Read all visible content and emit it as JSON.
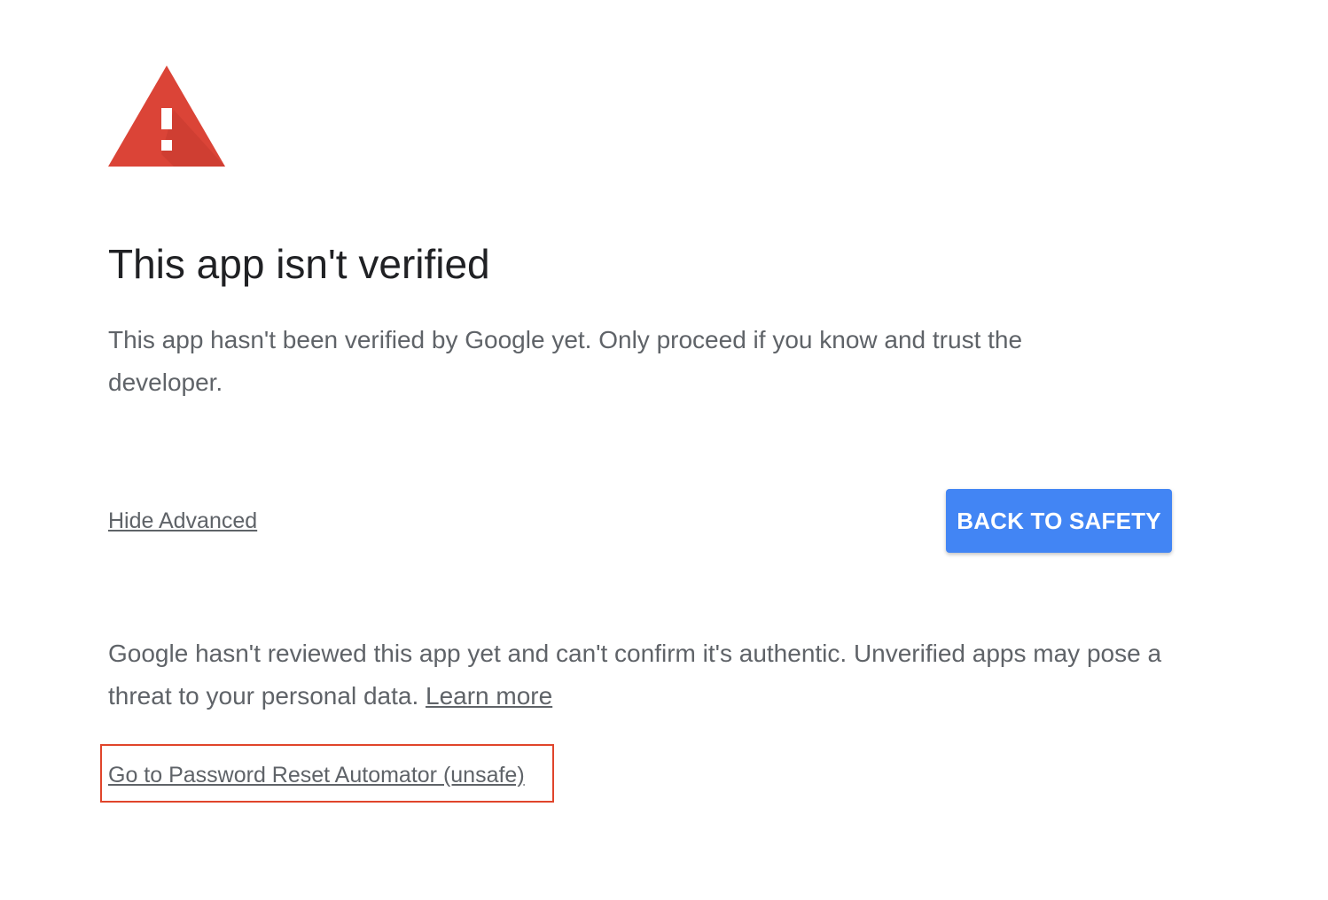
{
  "warning": {
    "icon": "warning-triangle-icon",
    "color": "#db4437",
    "shade_color": "#c53a2f"
  },
  "title": "This app isn't verified",
  "lead": "This app hasn't been verified by Google yet. Only proceed if you know and trust the developer.",
  "actions": {
    "hide_advanced_label": "Hide Advanced",
    "back_to_safety_label": "BACK TO SAFETY",
    "button_color": "#4285f4"
  },
  "details": {
    "text": "Google hasn't reviewed this app yet and can't confirm it's authentic. Unverified apps may pose a threat to your personal data.",
    "learn_more_label": "Learn more"
  },
  "proceed": {
    "label": "Go to Password Reset Automator (unsafe)",
    "highlight_color": "#e0452b"
  }
}
